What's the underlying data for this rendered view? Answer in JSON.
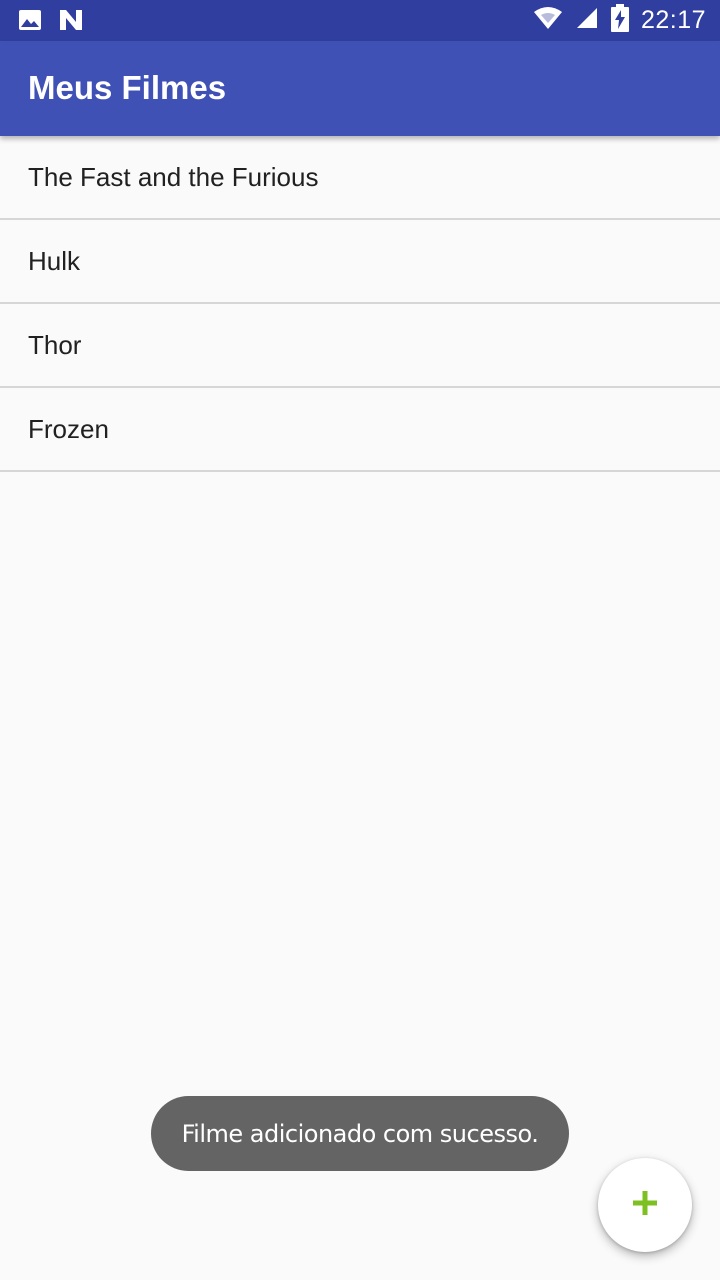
{
  "status_bar": {
    "time": "22:17",
    "left_icons": [
      "image-icon",
      "n-notification-icon"
    ],
    "right_icons": [
      "wifi-icon",
      "cell-signal-icon",
      "battery-charging-icon"
    ]
  },
  "app_bar": {
    "title": "Meus Filmes"
  },
  "movies": [
    {
      "title": "The Fast and the Furious"
    },
    {
      "title": "Hulk"
    },
    {
      "title": "Thor"
    },
    {
      "title": "Frozen"
    }
  ],
  "toast": {
    "message": "Filme adicionado com sucesso."
  },
  "fab": {
    "icon": "plus-icon"
  },
  "colors": {
    "status_bar": "#303f9f",
    "primary": "#3f51b5",
    "background": "#fafafa",
    "fab_icon": "#7cc021",
    "toast": "#646464",
    "divider": "#d6d6d6"
  }
}
